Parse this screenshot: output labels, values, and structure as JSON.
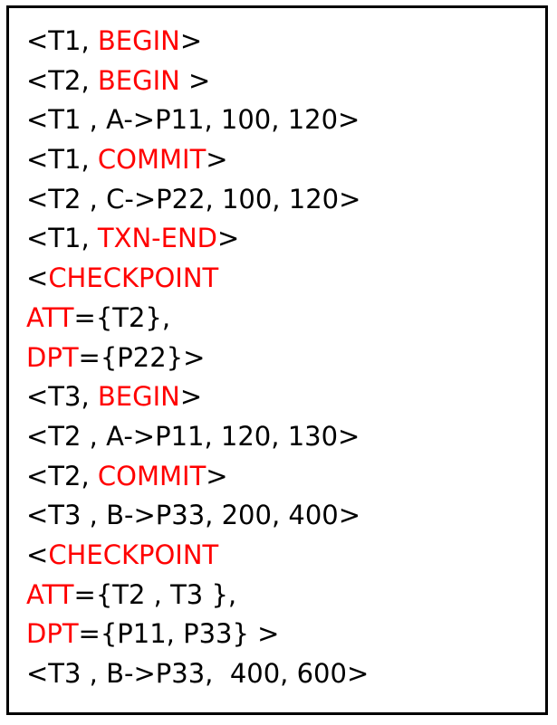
{
  "colors": {
    "text": "#000000",
    "keyword": "#ff0000",
    "border": "#000000",
    "background": "#ffffff"
  },
  "log": [
    [
      {
        "t": "<T1, ",
        "kw": false
      },
      {
        "t": "BEGIN",
        "kw": true
      },
      {
        "t": ">",
        "kw": false
      }
    ],
    [
      {
        "t": "<T2, ",
        "kw": false
      },
      {
        "t": "BEGIN",
        "kw": true
      },
      {
        "t": " >",
        "kw": false
      }
    ],
    [
      {
        "t": "<T1 , A->P11, 100, 120>",
        "kw": false
      }
    ],
    [
      {
        "t": "<T1, ",
        "kw": false
      },
      {
        "t": "COMMIT",
        "kw": true
      },
      {
        "t": ">",
        "kw": false
      }
    ],
    [
      {
        "t": "<T2 , C->P22, 100, 120>",
        "kw": false
      }
    ],
    [
      {
        "t": "<T1, ",
        "kw": false
      },
      {
        "t": "TXN-END",
        "kw": true
      },
      {
        "t": ">",
        "kw": false
      }
    ],
    [
      {
        "t": "<",
        "kw": false
      },
      {
        "t": "CHECKPOINT",
        "kw": true
      }
    ],
    [
      {
        "t": "ATT",
        "kw": true
      },
      {
        "t": "={T2},",
        "kw": false
      }
    ],
    [
      {
        "t": "DPT",
        "kw": true
      },
      {
        "t": "={P22}>",
        "kw": false
      }
    ],
    [
      {
        "t": "<T3, ",
        "kw": false
      },
      {
        "t": "BEGIN",
        "kw": true
      },
      {
        "t": ">",
        "kw": false
      }
    ],
    [
      {
        "t": "<T2 , A->P11, 120, 130>",
        "kw": false
      }
    ],
    [
      {
        "t": "<T2, ",
        "kw": false
      },
      {
        "t": "COMMIT",
        "kw": true
      },
      {
        "t": ">",
        "kw": false
      }
    ],
    [
      {
        "t": "<T3 , B->P33, 200, 400>",
        "kw": false
      }
    ],
    [
      {
        "t": "<",
        "kw": false
      },
      {
        "t": "CHECKPOINT",
        "kw": true
      }
    ],
    [
      {
        "t": "ATT",
        "kw": true
      },
      {
        "t": "={T2 , T3 },",
        "kw": false
      }
    ],
    [
      {
        "t": "DPT",
        "kw": true
      },
      {
        "t": "={P11, P33} >",
        "kw": false
      }
    ],
    [
      {
        "t": "<T3 , B->P33,  400, 600>",
        "kw": false
      }
    ]
  ]
}
